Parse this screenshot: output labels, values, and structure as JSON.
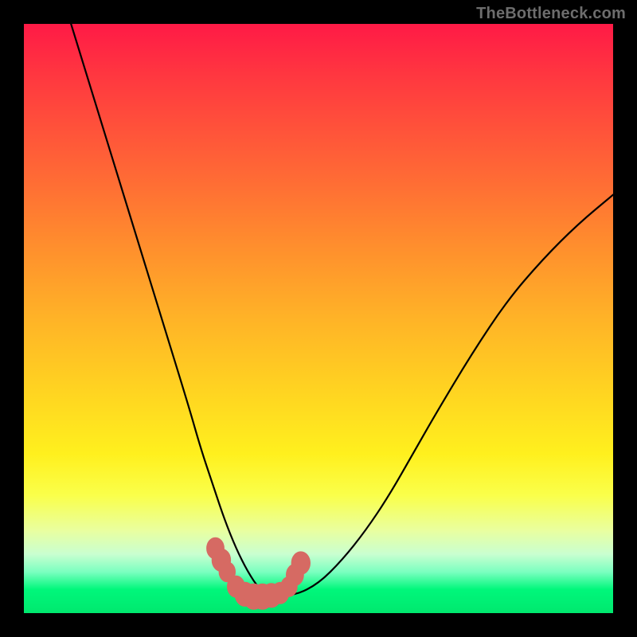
{
  "watermark": "TheBottleneck.com",
  "chart_data": {
    "type": "line",
    "title": "",
    "xlabel": "",
    "ylabel": "",
    "xlim": [
      0,
      100
    ],
    "ylim": [
      0,
      100
    ],
    "series": [
      {
        "name": "curve",
        "x": [
          8,
          12,
          16,
          20,
          24,
          28,
          30,
          32,
          34,
          36,
          38,
          40,
          42,
          46,
          50,
          54,
          58,
          62,
          66,
          70,
          76,
          82,
          88,
          94,
          100
        ],
        "y": [
          100,
          87,
          74,
          61,
          48,
          35,
          28,
          22,
          16,
          11,
          7,
          4,
          3,
          3,
          5,
          9,
          14,
          20,
          27,
          34,
          44,
          53,
          60,
          66,
          71
        ]
      }
    ],
    "markers": [
      {
        "x": 32.5,
        "y": 11,
        "size": 2.0
      },
      {
        "x": 33.5,
        "y": 9,
        "size": 2.2
      },
      {
        "x": 34.5,
        "y": 7,
        "size": 1.8
      },
      {
        "x": 36.0,
        "y": 4.5,
        "size": 2.0
      },
      {
        "x": 37.5,
        "y": 3.2,
        "size": 2.4
      },
      {
        "x": 39.0,
        "y": 2.8,
        "size": 2.6
      },
      {
        "x": 40.5,
        "y": 2.8,
        "size": 2.6
      },
      {
        "x": 42.0,
        "y": 3.0,
        "size": 2.4
      },
      {
        "x": 43.5,
        "y": 3.4,
        "size": 2.0
      },
      {
        "x": 45.0,
        "y": 4.5,
        "size": 1.8
      },
      {
        "x": 46.0,
        "y": 6.5,
        "size": 2.0
      },
      {
        "x": 47.0,
        "y": 8.5,
        "size": 2.2
      }
    ]
  }
}
